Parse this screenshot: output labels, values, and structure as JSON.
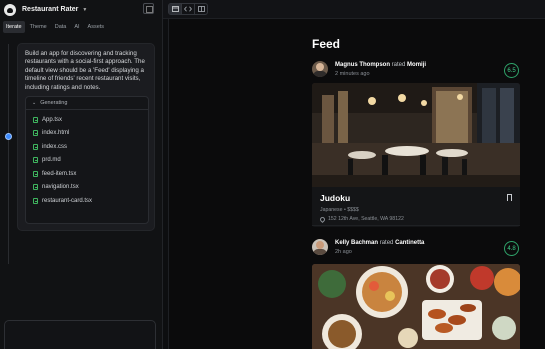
{
  "app": {
    "project_name": "Restaurant Rater",
    "tabs": [
      "Iterate",
      "Theme",
      "Data",
      "AI",
      "Assets"
    ],
    "active_tab": "Iterate"
  },
  "prompt": {
    "text": "Build an app for discovering and tracking restaurants with a social-first approach. The default view should be a 'Feed' displaying a timeline of friends' recent restaurant visits, including ratings and notes.",
    "generating_label": "Generating",
    "files": [
      "App.tsx",
      "index.html",
      "index.css",
      "prd.md",
      "feed-item.tsx",
      "navigation.tsx",
      "restaurant-card.tsx"
    ]
  },
  "toolbar": {
    "icons": [
      "browser-icon",
      "code-icon",
      "split-view-icon"
    ]
  },
  "feed": {
    "title": "Feed",
    "posts": [
      {
        "user": "Magnus Thompson",
        "action": "rated",
        "restaurant": "Momiji",
        "time": "2 minutes ago",
        "rating": "6.5",
        "card_name": "Judoku",
        "card_meta": "Japanese • $$$$",
        "card_address": "152 12th Ave, Seattle, WA 98122"
      },
      {
        "user": "Kelly Bachman",
        "action": "rated",
        "restaurant": "Cantinetta",
        "time": "2h ago",
        "rating": "4.8"
      }
    ]
  },
  "colors": {
    "accent": "#3d8bfd",
    "rating_green": "#3fd08a",
    "file_green": "#3fb65f"
  }
}
